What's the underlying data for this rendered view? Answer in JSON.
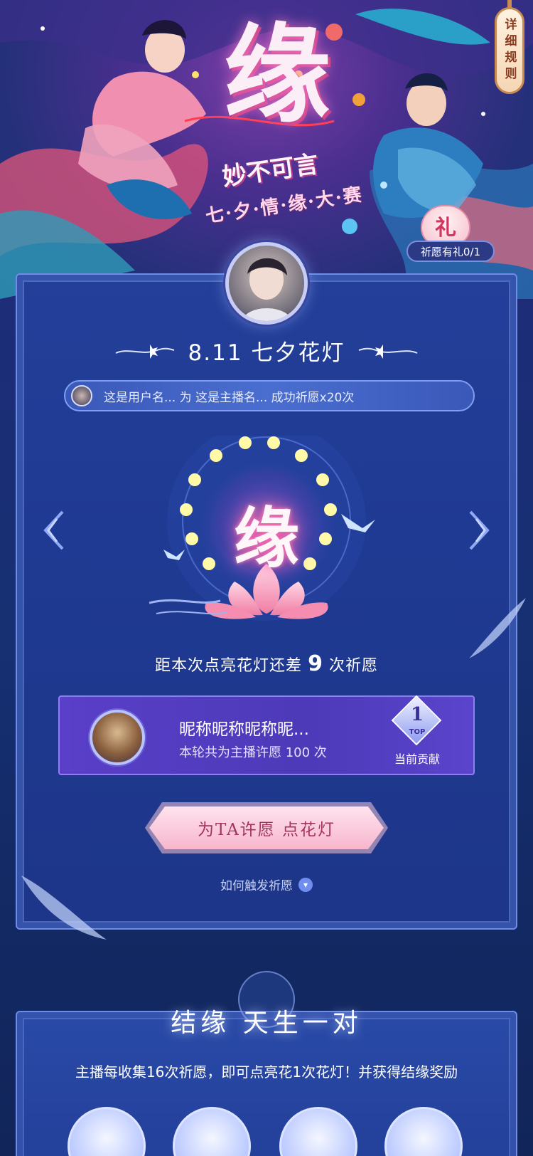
{
  "hero": {
    "title": "缘",
    "subtitle": "妙不可言",
    "event_name": "七·夕·情·缘·大·赛",
    "rules_button": "详细规则",
    "gift_icon_text": "礼",
    "gift_label": "祈愿有礼0/1"
  },
  "card": {
    "title": "8.11 七夕花灯",
    "notice": "这是用户名... 为 这是主播名... 成功祈愿x20次",
    "lantern_char": "缘",
    "progress_prefix": "距本次点亮花灯还差",
    "progress_count": "9",
    "progress_suffix": "次祈愿",
    "top_contributor": {
      "name": "昵称昵称昵称昵...",
      "count_text": "本轮共为主播许愿 100 次",
      "rank": "1",
      "rank_tag": "TOP",
      "rank_label": "当前贡献"
    },
    "wish_button": "为TA许愿 点花灯",
    "how_link": "如何触发祈愿"
  },
  "section2": {
    "title": "结缘 天生一对",
    "description": "主播每收集16次祈愿，即可点亮花1次花灯！并获得结缘奖励"
  },
  "colors": {
    "accent_pink": "#f7b6cd",
    "card_blue": "#1f3a92",
    "frame_border": "#6f8de6",
    "top_box_purple": "#4c3ab8"
  },
  "icons": {
    "nav_left": "chevron-double-left-icon",
    "nav_right": "chevron-double-right-icon",
    "how_toggle": "chevron-down-icon"
  }
}
